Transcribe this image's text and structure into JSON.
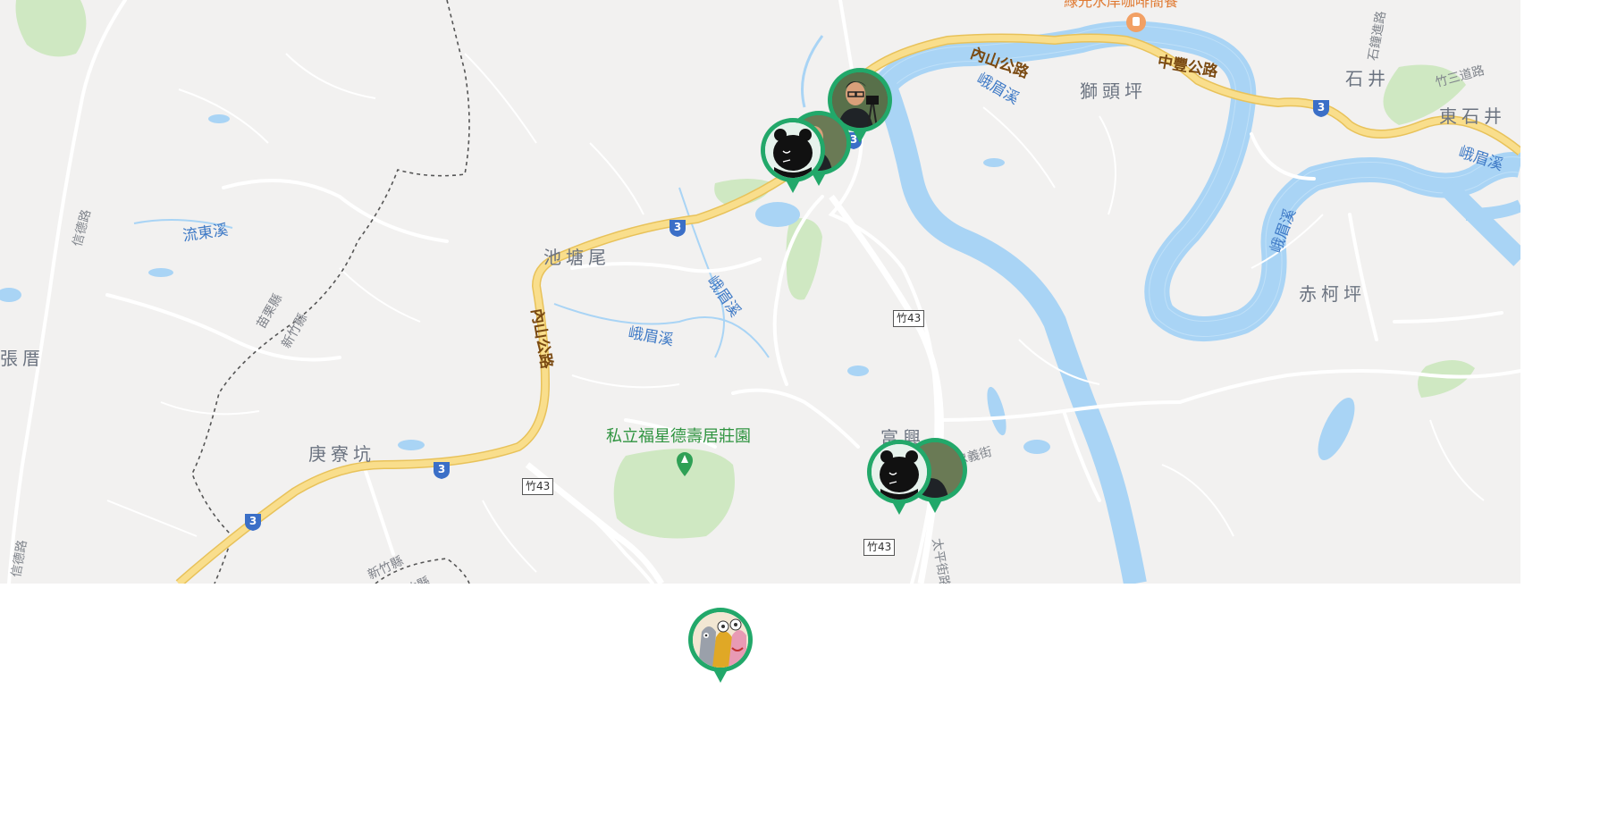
{
  "map": {
    "place_labels": [
      "獅頭坪",
      "石井",
      "東石井",
      "赤柯坪",
      "池塘尾",
      "庚寮坑",
      "張厝",
      "富興"
    ],
    "river_labels": [
      "峨眉溪",
      "峨眉溪",
      "峨眉溪",
      "峨眉溪",
      "峨眉溪",
      "流東溪"
    ],
    "road_labels": [
      "內山公路",
      "中豐公路",
      "內山公路"
    ],
    "minor_road_labels": [
      "信德路",
      "信德路",
      "石鐘進路",
      "竹三道路",
      "忠義街",
      "太平街路"
    ],
    "county_labels": [
      "苗栗縣",
      "新竹縣",
      "新竹縣",
      "新竹縣"
    ],
    "park_label": "私立福星德壽居莊園",
    "poi_label": "綠光水岸咖啡簡餐",
    "route_shields": [
      "3",
      "3",
      "3",
      "3",
      "3",
      "3"
    ],
    "county_road_boxes": [
      "竹43",
      "竹43",
      "竹43"
    ]
  },
  "markers": [
    {
      "name": "person-photo-marker",
      "avatar": "man-with-camera"
    },
    {
      "name": "bear-marker",
      "avatar": "black-bear"
    },
    {
      "name": "bear-marker-fuxing",
      "avatar": "black-bear"
    },
    {
      "name": "cartoon-marker",
      "avatar": "cartoon-characters"
    }
  ],
  "colors": {
    "map_bg": "#f2f1f0",
    "water": "#a9d4f5",
    "highway": "#f8d57a",
    "park": "#cfeac4",
    "marker": "#22a86a",
    "shield": "#3b6fc7"
  }
}
